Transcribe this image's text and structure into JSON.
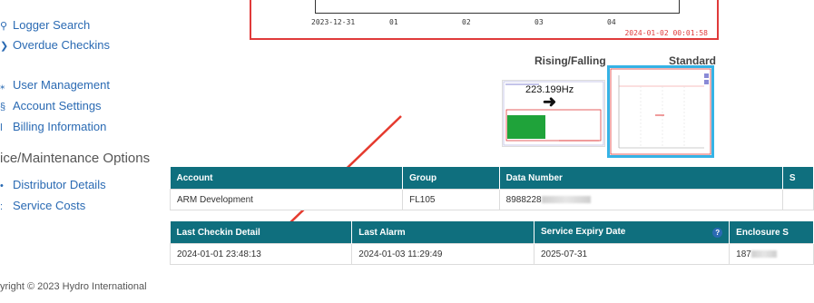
{
  "sidebar": {
    "items_top": [
      {
        "label": "Logger Search",
        "icon": "search-icon",
        "glyph": "⚲"
      },
      {
        "label": "Overdue Checkins",
        "icon": "clock-icon",
        "glyph": "❯"
      }
    ],
    "items_mid": [
      {
        "label": "User Management",
        "icon": "user-icon",
        "glyph": "⁎"
      },
      {
        "label": "Account Settings",
        "icon": "settings-icon",
        "glyph": "§"
      },
      {
        "label": "Billing Information",
        "icon": "billing-icon",
        "glyph": "ǀ"
      }
    ],
    "section_heading": "ice/Maintenance Options",
    "items_bottom": [
      {
        "label": "Distributor Details",
        "icon": "distributor-icon",
        "glyph": "•"
      },
      {
        "label": "Service Costs",
        "icon": "cost-icon",
        "glyph": ":"
      }
    ]
  },
  "chart": {
    "tick_labels": [
      "2023-12-31",
      "01",
      "02",
      "03",
      "04"
    ],
    "timestamp": "2024-01-02 00:01:58",
    "accent": "#e03a3a"
  },
  "thumbnails": {
    "rising_title": "Rising/Falling",
    "standard_title": "Standard",
    "frequency": "223.199Hz",
    "highlight": "#35b3e6"
  },
  "account_table": {
    "headers": [
      "Account",
      "Group",
      "Data Number",
      "S"
    ],
    "row": {
      "account": "ARM Development",
      "group": "FL105",
      "data_number": "8988228"
    }
  },
  "status_table": {
    "headers": [
      "Last Checkin Detail",
      "Last Alarm",
      "Service Expiry Date",
      "Enclosure S"
    ],
    "row": {
      "last_checkin": "2024-01-01 23:48:13",
      "last_alarm": "2024-01-03 11:29:49",
      "expiry": "2025-07-31",
      "enclosure": "187"
    }
  },
  "footer": {
    "copyright": "yright © 2023 Hydro International"
  },
  "colors": {
    "header_teal": "#0f6f7e",
    "link_blue": "#2a6ab3",
    "arrow_red": "#e53a2e"
  }
}
